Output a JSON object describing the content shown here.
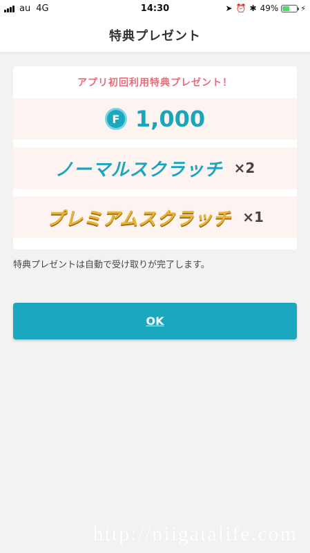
{
  "status_bar": {
    "carrier": "au",
    "network": "4G",
    "time": "14:30",
    "battery_percent": "49%",
    "battery_level": 0.49,
    "icons": [
      "location-icon",
      "alarm-icon",
      "bluetooth-icon",
      "charging-icon"
    ]
  },
  "nav": {
    "title": "特典プレゼント"
  },
  "card": {
    "header": "アプリ初回利用特典プレゼント！",
    "coin_letter": "F",
    "coin_amount": "1,000",
    "normal_scratch": "ノーマルスクラッチ",
    "normal_qty": "×2",
    "premium_scratch": "プレミアムスクラッチ",
    "premium_qty": "×1"
  },
  "note": "特典プレゼントは自動で受け取りが完了します。",
  "ok_button": "OK",
  "watermark": "http://niigatalife.com",
  "colors": {
    "accent": "#1ba7bd",
    "header_pink": "#e96a78",
    "gold": "#e6b33c",
    "row_bg": "#fdf3f1"
  }
}
